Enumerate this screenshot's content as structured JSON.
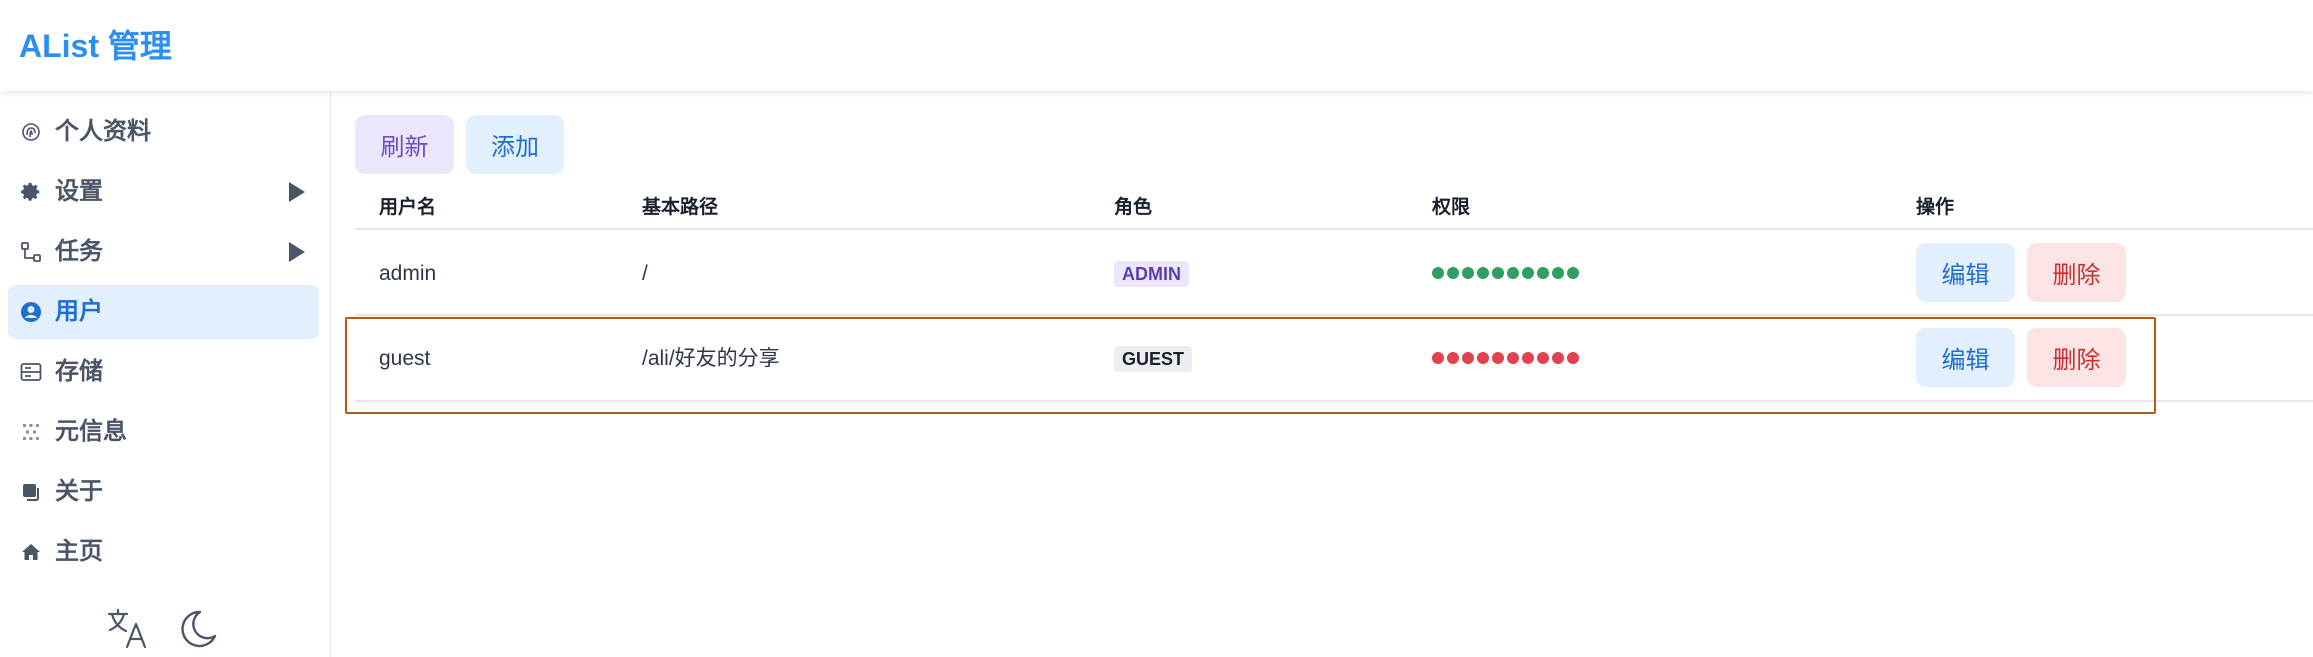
{
  "app": {
    "title": "AList 管理"
  },
  "sidebar": {
    "items": [
      {
        "label": "个人资料",
        "icon": "fingerprint-icon",
        "active": false
      },
      {
        "label": "设置",
        "icon": "gear-icon",
        "active": false,
        "expandable": true
      },
      {
        "label": "任务",
        "icon": "workflow-icon",
        "active": false,
        "expandable": true
      },
      {
        "label": "用户",
        "icon": "user-circle-icon",
        "active": true
      },
      {
        "label": "存储",
        "icon": "storage-icon",
        "active": false
      },
      {
        "label": "元信息",
        "icon": "meta-icon",
        "active": false
      },
      {
        "label": "关于",
        "icon": "copy-icon",
        "active": false
      },
      {
        "label": "主页",
        "icon": "home-icon",
        "active": false
      }
    ],
    "bottom": {
      "language_icon": "translate-icon",
      "theme_icon": "moon-icon"
    }
  },
  "toolbar": {
    "refresh_label": "刷新",
    "add_label": "添加"
  },
  "table": {
    "headers": [
      "用户名",
      "基本路径",
      "角色",
      "权限",
      "操作"
    ],
    "rows": [
      {
        "username": "admin",
        "base_path": "/",
        "role": "ADMIN",
        "permission_color": "#2f9e60",
        "edit_label": "编辑",
        "delete_label": "删除"
      },
      {
        "username": "guest",
        "base_path": "/ali/好友的分享",
        "role": "GUEST",
        "permission_color": "#e0434b",
        "edit_label": "编辑",
        "delete_label": "删除"
      }
    ]
  },
  "colors": {
    "accent": "#2b8ef0",
    "active_bg": "#e2effd",
    "highlight_border": "#b35a14"
  }
}
